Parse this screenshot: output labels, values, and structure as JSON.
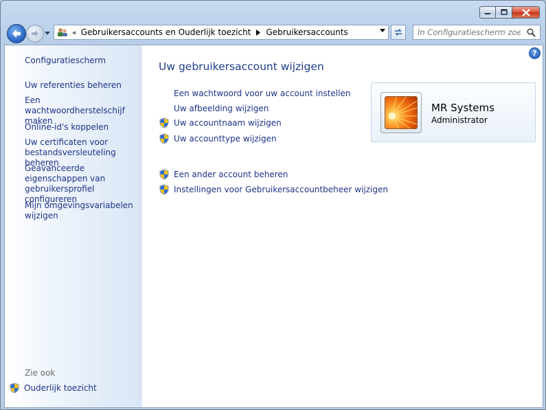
{
  "window": {
    "caption": {
      "minimize": "minimize",
      "maximize": "maximize",
      "close": "close"
    }
  },
  "nav": {
    "address": {
      "overflow": "«",
      "crumbs": [
        "Gebruikersaccounts en Ouderlijk toezicht",
        "Gebruikersaccounts"
      ]
    },
    "search_placeholder": "In Configuratiescherm zoeken"
  },
  "sidebar": {
    "home": "Configuratiescherm",
    "links": [
      "Uw referenties beheren",
      "Een wachtwoordherstelschijf maken",
      "Online-id's koppelen",
      "Uw certificaten voor bestandsversleuteling beheren",
      "Geavanceerde eigenschappen van gebruikersprofiel configureren",
      "Mijn omgevingsvariabelen wijzigen"
    ],
    "see_also": "Zie ook",
    "parental": "Ouderlijk toezicht"
  },
  "main": {
    "title": "Uw gebruikersaccount wijzigen",
    "tasks": [
      {
        "label": "Een wachtwoord voor uw account instellen",
        "shield": false
      },
      {
        "label": "Uw afbeelding wijzigen",
        "shield": false
      },
      {
        "label": "Uw accountnaam wijzigen",
        "shield": true
      },
      {
        "label": "Uw accounttype wijzigen",
        "shield": true
      }
    ],
    "other_tasks": [
      {
        "label": "Een ander account beheren",
        "shield": true
      },
      {
        "label": "Instellingen voor Gebruikersaccountbeheer wijzigen",
        "shield": true
      }
    ]
  },
  "user": {
    "name": "MR Systems",
    "role": "Administrator"
  },
  "icons": {
    "back": "back-arrow-icon",
    "forward": "forward-arrow-icon",
    "help": "help-icon",
    "shield": "uac-shield-icon",
    "search": "search-icon",
    "refresh": "refresh-icon"
  },
  "colors": {
    "link": "#1e3287",
    "title": "#1f3d8c",
    "frame": "#bed3ec"
  }
}
